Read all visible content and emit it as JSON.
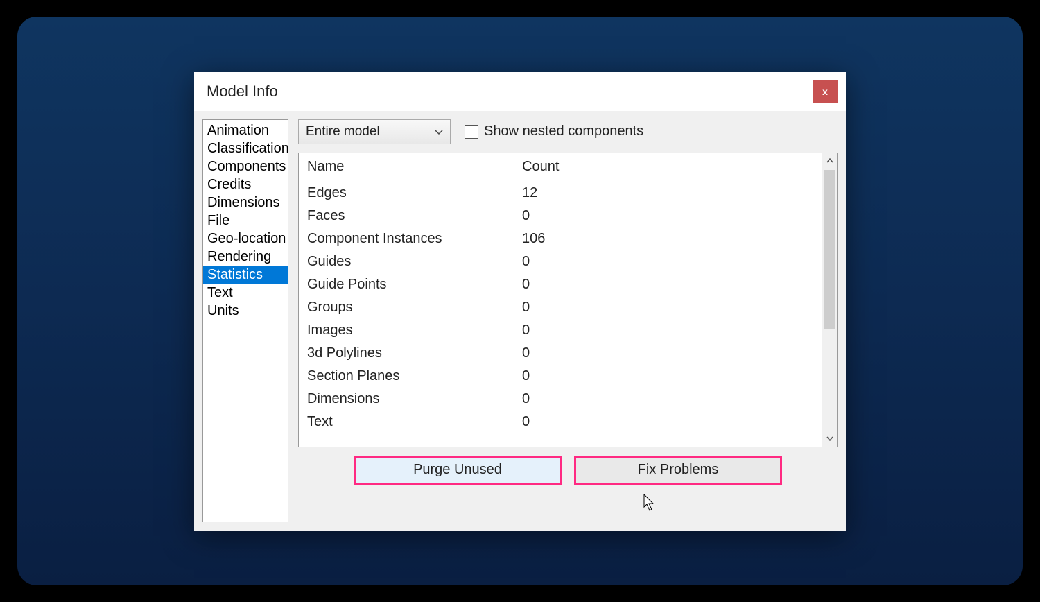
{
  "window": {
    "title": "Model Info",
    "close": "x"
  },
  "sidebar": {
    "items": [
      {
        "label": "Animation",
        "selected": false
      },
      {
        "label": "Classifications",
        "selected": false
      },
      {
        "label": "Components",
        "selected": false
      },
      {
        "label": "Credits",
        "selected": false
      },
      {
        "label": "Dimensions",
        "selected": false
      },
      {
        "label": "File",
        "selected": false
      },
      {
        "label": "Geo-location",
        "selected": false
      },
      {
        "label": "Rendering",
        "selected": false
      },
      {
        "label": "Statistics",
        "selected": true
      },
      {
        "label": "Text",
        "selected": false
      },
      {
        "label": "Units",
        "selected": false
      }
    ]
  },
  "controls": {
    "scope_dropdown": "Entire model",
    "show_nested_label": "Show nested components",
    "show_nested_checked": false
  },
  "table": {
    "header_name": "Name",
    "header_count": "Count",
    "rows": [
      {
        "name": "Edges",
        "count": "12"
      },
      {
        "name": "Faces",
        "count": "0"
      },
      {
        "name": "Component Instances",
        "count": "106"
      },
      {
        "name": "Guides",
        "count": "0"
      },
      {
        "name": "Guide Points",
        "count": "0"
      },
      {
        "name": "Groups",
        "count": "0"
      },
      {
        "name": "Images",
        "count": "0"
      },
      {
        "name": "3d Polylines",
        "count": "0"
      },
      {
        "name": "Section Planes",
        "count": "0"
      },
      {
        "name": "Dimensions",
        "count": "0"
      },
      {
        "name": "Text",
        "count": "0"
      }
    ]
  },
  "buttons": {
    "purge": "Purge Unused",
    "fix": "Fix Problems"
  }
}
